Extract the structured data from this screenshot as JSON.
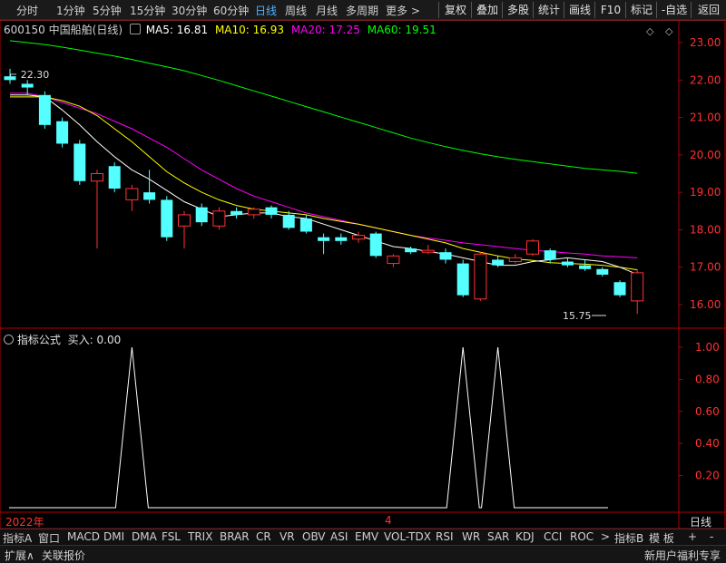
{
  "periods": [
    "分时",
    "1分钟",
    "5分钟",
    "15分钟",
    "30分钟",
    "60分钟",
    "日线",
    "周线",
    "月线",
    "多周期",
    "更多 >"
  ],
  "active_period": "日线",
  "right_buttons": [
    "复权",
    "叠加",
    "多股",
    "统计",
    "画线",
    "F10",
    "标记",
    "-自选",
    "返回"
  ],
  "stock": {
    "code": "600150",
    "name": "中国船舶",
    "period": "(日线)"
  },
  "ma": [
    {
      "label": "MA5: 16.81",
      "color": "#ffffff"
    },
    {
      "label": "MA10: 16.93",
      "color": "#ffff00"
    },
    {
      "label": "MA20: 17.25",
      "color": "#ff00ff"
    },
    {
      "label": "MA60: 19.51",
      "color": "#00ff00"
    }
  ],
  "price_axis": [
    "23.00",
    "22.00",
    "21.00",
    "20.00",
    "19.00",
    "18.00",
    "17.00",
    "16.00"
  ],
  "high_label": "22.30",
  "low_label": "15.75",
  "indicator": {
    "title": "指标公式",
    "value": "买入: 0.00"
  },
  "indicator_axis": [
    "1.00",
    "0.80",
    "0.60",
    "0.40",
    "0.20"
  ],
  "date_labels": {
    "left": "2022年",
    "mid": "4"
  },
  "bottom_tabs": [
    "指标A",
    "窗口",
    "MACD",
    "DMI",
    "DMA",
    "FSL",
    "TRIX",
    "BRAR",
    "CR",
    "VR",
    "OBV",
    "ASI",
    "EMV",
    "VOL-TDX",
    "RSI",
    "WR",
    "SAR",
    "KDJ",
    "CCI",
    "ROC",
    ">",
    "指标B",
    "模 板",
    "+",
    "-"
  ],
  "status": {
    "left1": "扩展∧",
    "left2": "关联报价",
    "right": "新用户福利专享"
  },
  "date_right_label": "日线",
  "colors": {
    "up": "#ff3232",
    "down": "#54ffff",
    "ma5": "#ffffff",
    "ma10": "#ffff00",
    "ma20": "#ff00ff",
    "ma60": "#00ff00",
    "frame": "#b40000"
  },
  "chart_data": {
    "type": "candlestick",
    "y_range": [
      15.6,
      23.3
    ],
    "candles": [
      {
        "o": 22.1,
        "c": 22.0,
        "h": 22.3,
        "l": 21.9
      },
      {
        "o": 21.9,
        "c": 21.8,
        "h": 22.0,
        "l": 21.6
      },
      {
        "o": 21.6,
        "c": 20.8,
        "h": 21.7,
        "l": 20.7
      },
      {
        "o": 20.9,
        "c": 20.3,
        "h": 21.0,
        "l": 20.2
      },
      {
        "o": 20.3,
        "c": 19.3,
        "h": 20.4,
        "l": 19.2
      },
      {
        "o": 19.3,
        "c": 19.5,
        "h": 19.6,
        "l": 17.5
      },
      {
        "o": 19.7,
        "c": 19.1,
        "h": 19.8,
        "l": 19.0
      },
      {
        "o": 18.8,
        "c": 19.1,
        "h": 19.2,
        "l": 18.5
      },
      {
        "o": 19.0,
        "c": 18.8,
        "h": 19.6,
        "l": 18.7
      },
      {
        "o": 18.8,
        "c": 17.8,
        "h": 18.9,
        "l": 17.7
      },
      {
        "o": 18.1,
        "c": 18.4,
        "h": 18.5,
        "l": 17.5
      },
      {
        "o": 18.6,
        "c": 18.2,
        "h": 18.7,
        "l": 18.1
      },
      {
        "o": 18.1,
        "c": 18.5,
        "h": 18.6,
        "l": 18.0
      },
      {
        "o": 18.5,
        "c": 18.4,
        "h": 18.6,
        "l": 18.3
      },
      {
        "o": 18.4,
        "c": 18.55,
        "h": 18.6,
        "l": 18.3
      },
      {
        "o": 18.6,
        "c": 18.4,
        "h": 18.65,
        "l": 18.3
      },
      {
        "o": 18.4,
        "c": 18.05,
        "h": 18.5,
        "l": 18.0
      },
      {
        "o": 18.3,
        "c": 17.95,
        "h": 18.4,
        "l": 17.9
      },
      {
        "o": 17.8,
        "c": 17.7,
        "h": 17.9,
        "l": 17.35
      },
      {
        "o": 17.8,
        "c": 17.7,
        "h": 17.9,
        "l": 17.6
      },
      {
        "o": 17.75,
        "c": 17.85,
        "h": 17.95,
        "l": 17.65
      },
      {
        "o": 17.9,
        "c": 17.3,
        "h": 17.95,
        "l": 17.25
      },
      {
        "o": 17.1,
        "c": 17.3,
        "h": 17.35,
        "l": 17.0
      },
      {
        "o": 17.5,
        "c": 17.4,
        "h": 17.55,
        "l": 17.35
      },
      {
        "o": 17.4,
        "c": 17.45,
        "h": 17.6,
        "l": 17.35
      },
      {
        "o": 17.4,
        "c": 17.2,
        "h": 17.5,
        "l": 17.1
      },
      {
        "o": 17.1,
        "c": 16.25,
        "h": 17.2,
        "l": 16.2
      },
      {
        "o": 16.15,
        "c": 17.35,
        "h": 17.4,
        "l": 16.1
      },
      {
        "o": 17.2,
        "c": 17.05,
        "h": 17.3,
        "l": 17.0
      },
      {
        "o": 17.15,
        "c": 17.25,
        "h": 17.35,
        "l": 17.1
      },
      {
        "o": 17.35,
        "c": 17.7,
        "h": 17.75,
        "l": 17.3
      },
      {
        "o": 17.45,
        "c": 17.2,
        "h": 17.5,
        "l": 17.1
      },
      {
        "o": 17.15,
        "c": 17.05,
        "h": 17.25,
        "l": 17.0
      },
      {
        "o": 17.05,
        "c": 16.95,
        "h": 17.2,
        "l": 16.9
      },
      {
        "o": 16.95,
        "c": 16.8,
        "h": 17.0,
        "l": 16.75
      },
      {
        "o": 16.6,
        "c": 16.25,
        "h": 16.65,
        "l": 16.2
      },
      {
        "o": 16.1,
        "c": 16.85,
        "h": 16.95,
        "l": 15.75
      }
    ],
    "ma5": [
      21.6,
      21.6,
      21.55,
      21.2,
      20.8,
      20.35,
      19.95,
      19.6,
      19.35,
      19.05,
      18.75,
      18.55,
      18.35,
      18.4,
      18.45,
      18.45,
      18.35,
      18.3,
      18.15,
      18.0,
      17.85,
      17.7,
      17.55,
      17.5,
      17.42,
      17.35,
      17.25,
      17.15,
      17.05,
      17.05,
      17.15,
      17.2,
      17.25,
      17.2,
      17.15,
      17.0,
      16.81
    ],
    "ma10": [
      21.55,
      21.55,
      21.55,
      21.45,
      21.3,
      21.05,
      20.7,
      20.35,
      19.95,
      19.55,
      19.25,
      19.0,
      18.8,
      18.65,
      18.55,
      18.5,
      18.45,
      18.4,
      18.3,
      18.22,
      18.15,
      18.05,
      17.95,
      17.85,
      17.75,
      17.65,
      17.5,
      17.4,
      17.3,
      17.22,
      17.18,
      17.12,
      17.1,
      17.08,
      17.05,
      17.0,
      16.93
    ],
    "ma20": [
      21.65,
      21.65,
      21.55,
      21.4,
      21.25,
      21.1,
      20.9,
      20.7,
      20.45,
      20.2,
      19.9,
      19.6,
      19.35,
      19.1,
      18.9,
      18.75,
      18.6,
      18.45,
      18.35,
      18.25,
      18.15,
      18.05,
      17.95,
      17.85,
      17.78,
      17.72,
      17.65,
      17.6,
      17.55,
      17.5,
      17.45,
      17.42,
      17.38,
      17.35,
      17.3,
      17.28,
      17.25
    ],
    "ma60": [
      23.05,
      23.0,
      22.95,
      22.88,
      22.8,
      22.72,
      22.64,
      22.55,
      22.45,
      22.35,
      22.25,
      22.12,
      21.99,
      21.85,
      21.71,
      21.57,
      21.43,
      21.29,
      21.15,
      21.01,
      20.87,
      20.73,
      20.59,
      20.45,
      20.33,
      20.22,
      20.12,
      20.03,
      19.95,
      19.88,
      19.82,
      19.76,
      19.7,
      19.64,
      19.6,
      19.56,
      19.51
    ],
    "signal": [
      0,
      0,
      0,
      0,
      0,
      0,
      0,
      1,
      0,
      0,
      0,
      0,
      0,
      0,
      0,
      0,
      0,
      0,
      0,
      0,
      0,
      0,
      0,
      0,
      0,
      0,
      1,
      0,
      1,
      0,
      0,
      0,
      0,
      0,
      0,
      0,
      0
    ]
  }
}
